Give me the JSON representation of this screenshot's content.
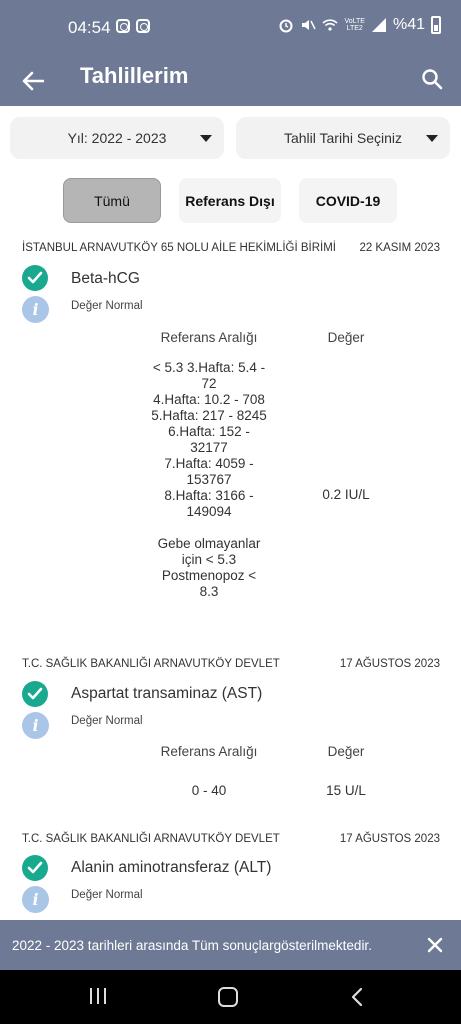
{
  "status_bar": {
    "time": "04:54",
    "battery_text": "%41",
    "volte_line1": "VoLTE",
    "volte_line2": "LTE2"
  },
  "app_bar": {
    "title": "Tahlillerim",
    "back_icon": "arrow-left-icon",
    "search_icon": "search-icon"
  },
  "filters": {
    "year_label": "Yıl: 2022 - 2023",
    "date_label": "Tahlil Tarihi Seçiniz"
  },
  "tabs": [
    {
      "label": "Tümü",
      "active": true
    },
    {
      "label": "Referans Dışı",
      "active": false
    },
    {
      "label": "COVID-19",
      "active": false
    }
  ],
  "results": [
    {
      "facility": "İSTANBUL ARNAVUTKÖY 65 NOLU AİLE HEKİMLİĞİ BİRİMİ",
      "date": "22 KASIM 2023",
      "test": "Beta-hCG",
      "status": "Değer Normal",
      "ref_header": "Referans Aralığı",
      "val_header": "Değer",
      "reference": "< 5.3  3.Hafta: 5.4 -\n72\n4.Hafta: 10.2 - 708\n5.Hafta: 217 - 8245\n6.Hafta: 152 -\n32177\n7.Hafta: 4059 -\n153767\n8.Hafta: 3166 -\n149094\n\nGebe olmayanlar\niçin < 5.3\nPostmenopoz  <\n8.3",
      "value": "0.2 IU/L"
    },
    {
      "facility": "T.C. SAĞLIK BAKANLIĞI ARNAVUTKÖY DEVLET",
      "date": "17 AĞUSTOS 2023",
      "test": "Aspartat transaminaz (AST)",
      "status": "Değer Normal",
      "ref_header": "Referans Aralığı",
      "val_header": "Değer",
      "reference": "0 - 40",
      "value": "15 U/L"
    },
    {
      "facility": "T.C. SAĞLIK BAKANLIĞI ARNAVUTKÖY DEVLET",
      "date": "17 AĞUSTOS 2023",
      "test": "Alanin aminotransferaz (ALT)",
      "status": "Değer Normal"
    }
  ],
  "snackbar": {
    "text": "2022 - 2023 tarihleri arasında Tüm sonuçlargösterilmektedir."
  },
  "colors": {
    "primary": "#6e7a95",
    "success": "#19a98f",
    "info": "#a9c6e6"
  }
}
